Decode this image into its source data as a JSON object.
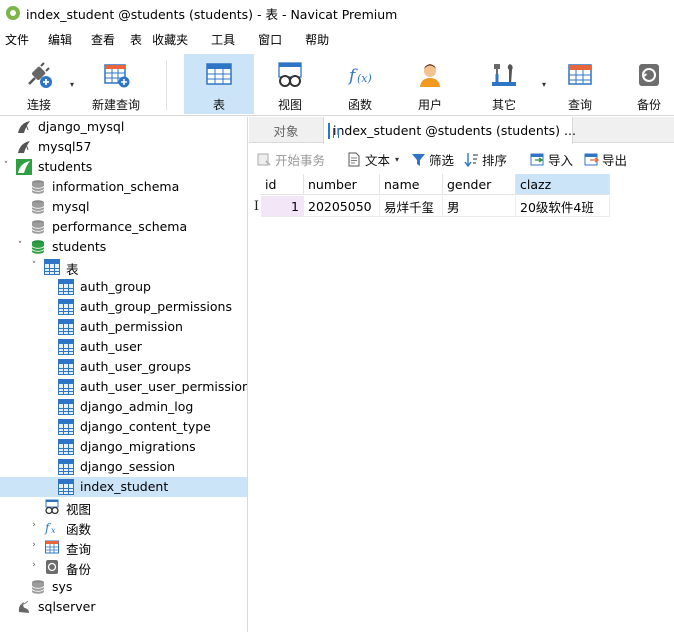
{
  "window": {
    "title": "index_student @students (students) - 表 - Navicat Premium"
  },
  "menu": [
    "文件",
    "编辑",
    "查看",
    "表",
    "收藏夹",
    "工具",
    "窗口",
    "帮助"
  ],
  "toolbar": {
    "connect": "连接",
    "new_query": "新建查询",
    "table": "表",
    "view": "视图",
    "function": "函数",
    "user": "用户",
    "other": "其它",
    "query": "查询",
    "backup": "备份"
  },
  "tree": {
    "conn1": "django_mysql",
    "conn2": "mysql57",
    "conn3": "students",
    "db1": "information_schema",
    "db2": "mysql",
    "db3": "performance_schema",
    "db4": "students",
    "tables_node": "表",
    "tables": [
      "auth_group",
      "auth_group_permissions",
      "auth_permission",
      "auth_user",
      "auth_user_groups",
      "auth_user_user_permissions",
      "django_admin_log",
      "django_content_type",
      "django_migrations",
      "django_session",
      "index_student"
    ],
    "views_node": "视图",
    "functions_node": "函数",
    "queries_node": "查询",
    "backups_node": "备份",
    "db5": "sys",
    "conn4": "sqlserver"
  },
  "tabs": {
    "objects": "对象",
    "active": "index_student @students (students) ..."
  },
  "subtoolbar": {
    "begin_tx": "开始事务",
    "text": "文本",
    "filter": "筛选",
    "sort": "排序",
    "import": "导入",
    "export": "导出"
  },
  "grid": {
    "columns": [
      "id",
      "number",
      "name",
      "gender",
      "clazz"
    ],
    "rows": [
      {
        "id": "1",
        "number": "20205050",
        "name": "易烊千玺",
        "gender": "男",
        "clazz": "20级软件4班"
      }
    ],
    "row_marker": "I"
  },
  "colors": {
    "selection": "#cce4f7",
    "accent": "#2f75c5",
    "db_green": "#22a34a"
  }
}
